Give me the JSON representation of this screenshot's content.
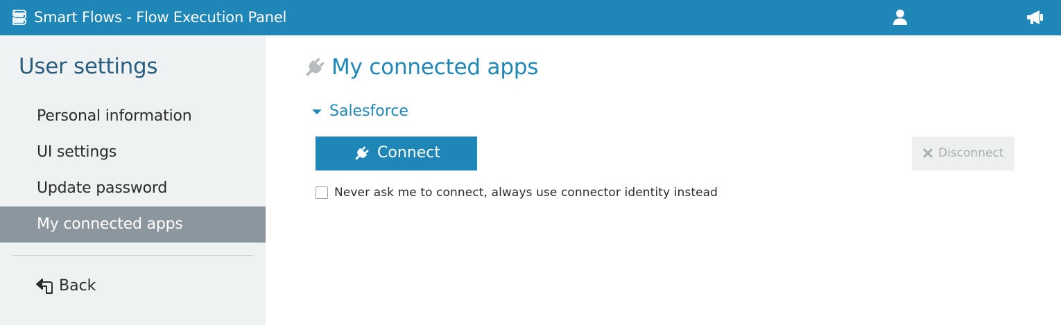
{
  "header": {
    "app_title": "Smart Flows - Flow Execution Panel",
    "app_icon": "layers-icon",
    "user_icon": "user-icon",
    "announcements_icon": "megaphone-icon"
  },
  "sidebar": {
    "title": "User settings",
    "items": [
      {
        "label": "Personal information",
        "active": false
      },
      {
        "label": "UI settings",
        "active": false
      },
      {
        "label": "Update password",
        "active": false
      },
      {
        "label": "My connected apps",
        "active": true
      }
    ],
    "back_label": "Back",
    "back_icon": "back-arrow-icon"
  },
  "main": {
    "title": "My connected apps",
    "title_icon": "plug-icon",
    "section": {
      "label": "Salesforce",
      "expanded": true,
      "connect_label": "Connect",
      "disconnect_label": "Disconnect",
      "disconnect_enabled": false,
      "checkbox_label": "Never ask me to connect, always use connector identity instead",
      "checkbox_checked": false
    }
  },
  "colors": {
    "header_bg": "#1f87b8",
    "sidebar_bg": "#eef2f2",
    "active_item_bg": "#8c969e",
    "accent": "#1f87b8",
    "sidebar_title": "#2a5d7e",
    "disabled_text": "#a8adb1"
  }
}
